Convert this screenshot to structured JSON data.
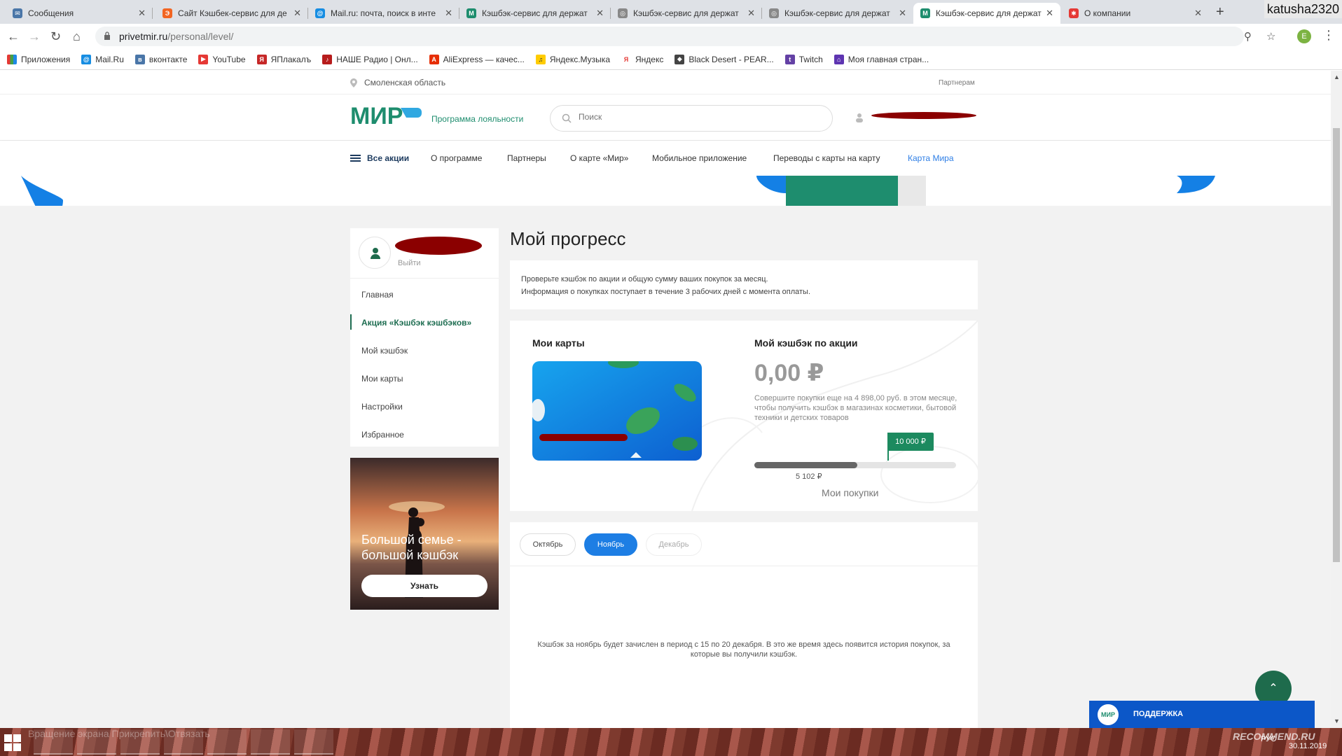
{
  "browser": {
    "tabs": [
      {
        "label": "Сообщения",
        "color": "#4a76a8"
      },
      {
        "label": "Сайт Кэшбек-сервис для де",
        "color": "#f26522"
      },
      {
        "label": "Mail.ru: почта, поиск в инте",
        "color": "#168de2"
      },
      {
        "label": "Кэшбэк-сервис для держат",
        "color": "#1e8d6e"
      },
      {
        "label": "Кэшбэк-сервис для держат",
        "color": "#888888"
      },
      {
        "label": "Кэшбэк-сервис для держат",
        "color": "#888888"
      },
      {
        "label": "Кэшбэк-сервис для держат",
        "color": "#1e8d6e"
      },
      {
        "label": "О компании",
        "color": "#e53935"
      }
    ],
    "active_tab_index": 6,
    "username": "katusha2320",
    "url_host": "privetmir.ru",
    "url_path": "/personal/level/",
    "profile_letter": "E",
    "bookmarks": [
      {
        "label": "Приложения",
        "icon": "apps-grid-icon"
      },
      {
        "label": "Mail.Ru",
        "icon": "mailru-icon"
      },
      {
        "label": "вконтакте",
        "icon": "vk-icon"
      },
      {
        "label": "YouTube",
        "icon": "youtube-icon"
      },
      {
        "label": "ЯПлакалъ",
        "icon": "yaplakal-icon"
      },
      {
        "label": "НАШЕ Радио | Онл...",
        "icon": "nashe-radio-icon"
      },
      {
        "label": "AliExpress — качес...",
        "icon": "aliexpress-icon"
      },
      {
        "label": "Яндекс.Музыка",
        "icon": "yandex-music-icon"
      },
      {
        "label": "Яндекс",
        "icon": "yandex-icon"
      },
      {
        "label": "Black Desert - PEAR...",
        "icon": "black-desert-icon"
      },
      {
        "label": "Twitch",
        "icon": "twitch-icon"
      },
      {
        "label": "Моя главная стран...",
        "icon": "homepage-icon"
      }
    ]
  },
  "site": {
    "region": "Смоленская область",
    "partners_link": "Партнерам",
    "logo_text": "МИР",
    "loyalty_label": "Программа лояльности",
    "search_placeholder": "Поиск",
    "nav": [
      {
        "label": "Все акции"
      },
      {
        "label": "О программе"
      },
      {
        "label": "Партнеры"
      },
      {
        "label": "О карте «Мир»"
      },
      {
        "label": "Мобильное приложение"
      },
      {
        "label": "Переводы с карты на карту"
      },
      {
        "label": "Карта Мира"
      }
    ]
  },
  "sidebar": {
    "logout": "Выйти",
    "items": [
      {
        "label": "Главная"
      },
      {
        "label": "Акция «Кэшбэк кэшбэков»"
      },
      {
        "label": "Мой кэшбэк"
      },
      {
        "label": "Мои карты"
      },
      {
        "label": "Настройки"
      },
      {
        "label": "Избранное"
      }
    ],
    "active_index": 1,
    "promo": {
      "title": "Большой семье - большой кэшбэк",
      "button": "Узнать"
    }
  },
  "main": {
    "title": "Мой прогресс",
    "info_line1": "Проверьте кэшбэк по акции и общую сумму ваших покупок за месяц.",
    "info_line2": "Информация о покупках поступает в течение 3 рабочих дней с момента оплаты.",
    "cards_heading": "Мои карты",
    "cashback_heading": "Мой кэшбэк по акции",
    "cashback_amount": "0,00 ₽",
    "cashback_note": "Совершите покупки еще на 4 898,00 руб. в этом месяце, чтобы получить кэшбэк в магазинах косметики, бытовой техники и детских товаров",
    "goal_label": "10 000 ₽",
    "progress_value_label": "5 102 ₽",
    "progress_fraction": 0.5102,
    "purchases_label": "Мои покупки",
    "months": [
      {
        "label": "Октябрь",
        "state": "off"
      },
      {
        "label": "Ноябрь",
        "state": "on"
      },
      {
        "label": "Декабрь",
        "state": "dis"
      }
    ],
    "months_message": "Кэшбэк за ноябрь будет зачислен в период с 15 по 20 декабря. В это же время здесь появится история покупок, за которые вы получили кэшбэк."
  },
  "support": {
    "label": "ПОДДЕРЖКА",
    "logo": "МИР"
  },
  "taskbar": {
    "ghost_text": "Вращение экрана   Прикрепить\\Отвязать",
    "lang": "РУС",
    "date": "30.11.2019",
    "watermark": "RECOMMEND.RU"
  },
  "colors": {
    "brand_green": "#1e8d6e",
    "accent_blue": "#1d7ee4",
    "support_blue": "#0c57c8"
  }
}
